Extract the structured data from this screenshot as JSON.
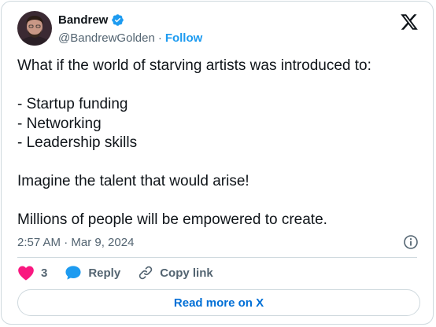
{
  "author": {
    "name": "Bandrew",
    "handle": "@BandrewGolden",
    "separator": "·",
    "follow_label": "Follow",
    "verified": true
  },
  "tweet": {
    "lines": [
      "What if the world of starving artists was introduced to:",
      "",
      "- Startup funding",
      "- Networking",
      "- Leadership skills",
      "",
      "Imagine the talent that would arise!",
      "",
      "Millions of people will be empowered to create."
    ],
    "timestamp": "2:57 AM · Mar 9, 2024"
  },
  "actions": {
    "like_count": "3",
    "reply_label": "Reply",
    "copy_link_label": "Copy link"
  },
  "read_more_label": "Read more on X",
  "colors": {
    "accent": "#1d9bf0",
    "like": "#f91880",
    "text": "#0f1419",
    "muted": "#536471",
    "border": "#cfd9de"
  },
  "icons": {
    "avatar": "avatar",
    "verified": "verified-badge-icon",
    "logo": "x-logo-icon",
    "info": "info-icon",
    "like": "heart-icon",
    "reply": "speech-bubble-icon",
    "copy_link": "link-icon"
  }
}
